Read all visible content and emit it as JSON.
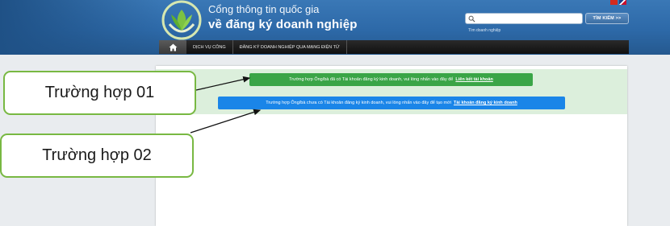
{
  "header": {
    "title_line1": "Cổng thông tin quốc gia",
    "title_line2": "về đăng ký doanh nghiệp",
    "search": {
      "placeholder": "",
      "button_label": "TÌM KIẾM >>",
      "hint": "Tìm doanh nghiệp"
    },
    "languages": [
      "vi",
      "en"
    ]
  },
  "navbar": {
    "home_icon": "home-icon",
    "items": [
      {
        "label": "DỊCH VỤ CÔNG"
      },
      {
        "label": "ĐĂNG KÝ DOANH NGHIỆP QUA MẠNG ĐIỆN TỬ"
      }
    ]
  },
  "notices": {
    "green": {
      "text": "Trường hợp Ông/bà đã có Tài khoản đăng ký kinh doanh, vui lòng nhấn vào đây để",
      "link": "Liên kết tài khoản"
    },
    "blue": {
      "text": "Trường hợp Ông/bà chưa có Tài khoản đăng ký kinh doanh, vui lòng nhấn vào đây để tạo mới",
      "link": "Tài khoản đăng ký kinh doanh"
    }
  },
  "callouts": {
    "case_01": "Trường hợp 01",
    "case_02": "Trường hợp 02"
  },
  "colors": {
    "header_blue": "#2d69a8",
    "nav_black": "#1a1a1a",
    "green_banner": "#3aa547",
    "blue_banner": "#1a85e8",
    "notice_strip": "#dcefdc",
    "callout_border": "#78b842"
  }
}
